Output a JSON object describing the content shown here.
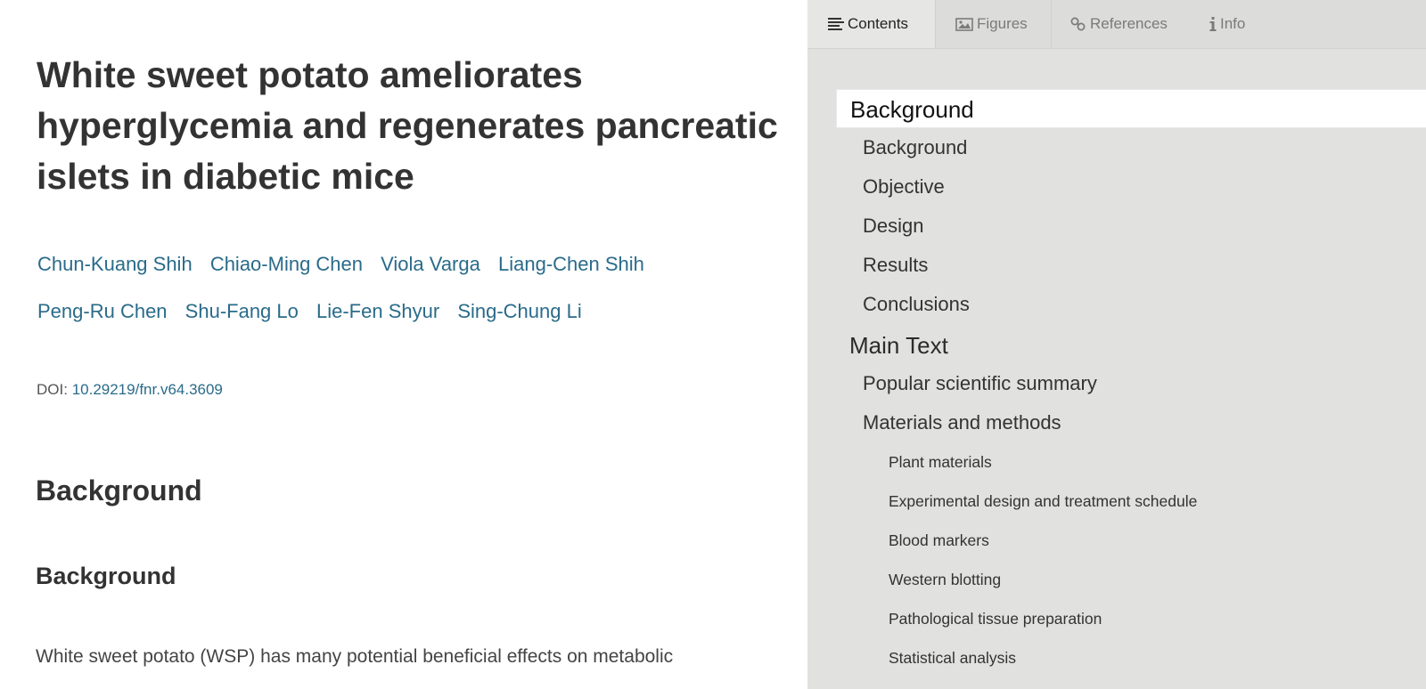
{
  "article": {
    "title": "White sweet potato ameliorates hyperglycemia and regenerates pancreatic islets in diabetic mice",
    "authors": [
      "Chun-Kuang Shih",
      "Chiao-Ming Chen",
      "Viola Varga",
      "Liang-Chen Shih",
      "Peng-Ru Chen",
      "Shu-Fang Lo",
      "Lie-Fen Shyur",
      "Sing-Chung Li"
    ],
    "doi_label": "DOI:",
    "doi_value": "10.29219/fnr.v64.3609",
    "section_heading": "Background",
    "subsection_heading": "Background",
    "body_text": "White sweet potato (WSP) has many potential beneficial effects on metabolic"
  },
  "sidebar": {
    "tabs": [
      {
        "label": "Contents",
        "icon": "list-icon",
        "active": true
      },
      {
        "label": "Figures",
        "icon": "image-icon",
        "active": false
      },
      {
        "label": "References",
        "icon": "link-icon",
        "active": false
      },
      {
        "label": "Info",
        "icon": "info-icon",
        "active": false
      }
    ],
    "toc": [
      {
        "label": "Background",
        "level": 1,
        "active": true
      },
      {
        "label": "Background",
        "level": 2
      },
      {
        "label": "Objective",
        "level": 2
      },
      {
        "label": "Design",
        "level": 2
      },
      {
        "label": "Results",
        "level": 2
      },
      {
        "label": "Conclusions",
        "level": 2
      },
      {
        "label": "Main Text",
        "level": 1
      },
      {
        "label": "Popular scientific summary",
        "level": 2
      },
      {
        "label": "Materials and methods",
        "level": 2
      },
      {
        "label": "Plant materials",
        "level": 3
      },
      {
        "label": "Experimental design and treatment schedule",
        "level": 3
      },
      {
        "label": "Blood markers",
        "level": 3
      },
      {
        "label": "Western blotting",
        "level": 3
      },
      {
        "label": "Pathological tissue preparation",
        "level": 3
      },
      {
        "label": "Statistical analysis",
        "level": 3
      }
    ]
  },
  "colors": {
    "link": "#2a6b8a",
    "sidebar_bg": "#e1e1e0",
    "active_toc_bg": "#ffffff"
  }
}
